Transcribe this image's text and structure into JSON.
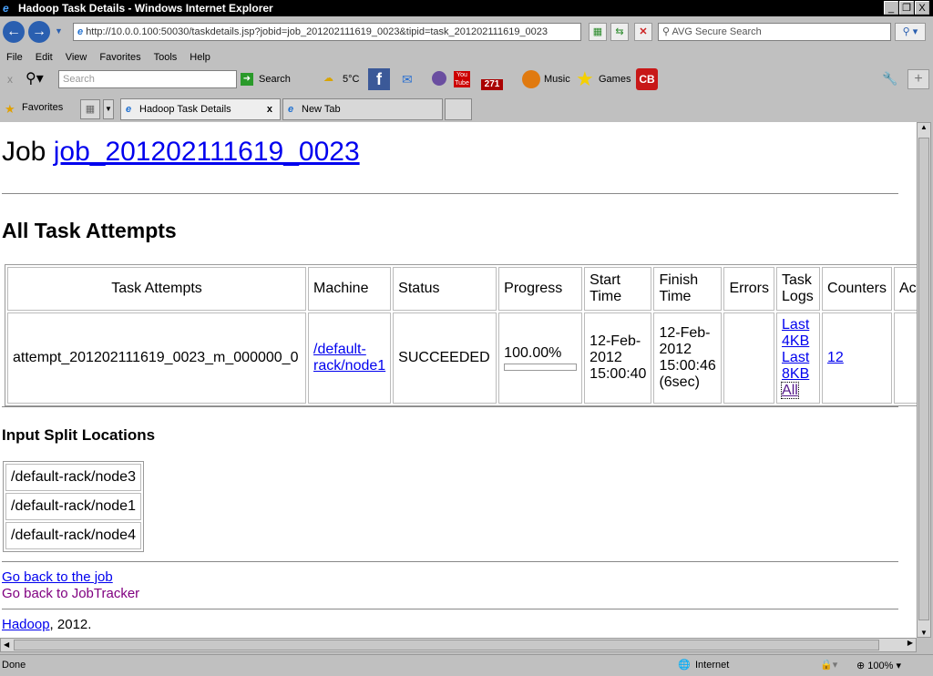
{
  "window": {
    "title": "Hadoop Task Details - Windows Internet Explorer"
  },
  "nav": {
    "url": "http://10.0.0.100:50030/taskdetails.jsp?jobid=job_201202111619_0023&tipid=task_201202111619_0023",
    "search_placeholder": "AVG Secure Search"
  },
  "menu": [
    "File",
    "Edit",
    "View",
    "Favorites",
    "Tools",
    "Help"
  ],
  "toolbar": {
    "search_placeholder": "Search",
    "search_label": "Search",
    "weather": "5°C",
    "mail_count": "271",
    "music": "Music",
    "games": "Games",
    "cb": "CB"
  },
  "favorites_label": "Favorites",
  "tabs": [
    {
      "label": "Hadoop Task Details",
      "active": true
    },
    {
      "label": "New Tab",
      "active": false
    }
  ],
  "page": {
    "job_prefix": "Job ",
    "job_id": "job_201202111619_0023",
    "attempts_heading": "All Task Attempts",
    "headers": [
      "Task Attempts",
      "Machine",
      "Status",
      "Progress",
      "Start Time",
      "Finish Time",
      "Errors",
      "Task Logs",
      "Counters",
      "Acti"
    ],
    "row": {
      "attempt": "attempt_201202111619_0023_m_000000_0",
      "machine": "/default-rack/node1",
      "status": "SUCCEEDED",
      "progress": "100.00%",
      "progress_value": 100,
      "start": "12-Feb-2012 15:00:40",
      "finish": "12-Feb-2012 15:00:46 (6sec)",
      "errors": "",
      "logs": [
        "Last 4KB",
        "Last 8KB",
        "All"
      ],
      "counters": "12"
    },
    "splits_heading": "Input Split Locations",
    "splits": [
      "/default-rack/node3",
      "/default-rack/node1",
      "/default-rack/node4"
    ],
    "back_job": "Go back to the job",
    "back_tracker": "Go back to JobTracker",
    "footer_link": "Hadoop",
    "footer_text": ", 2012."
  },
  "status": {
    "text": "Done",
    "zone": "Internet",
    "zoom": "100%"
  }
}
